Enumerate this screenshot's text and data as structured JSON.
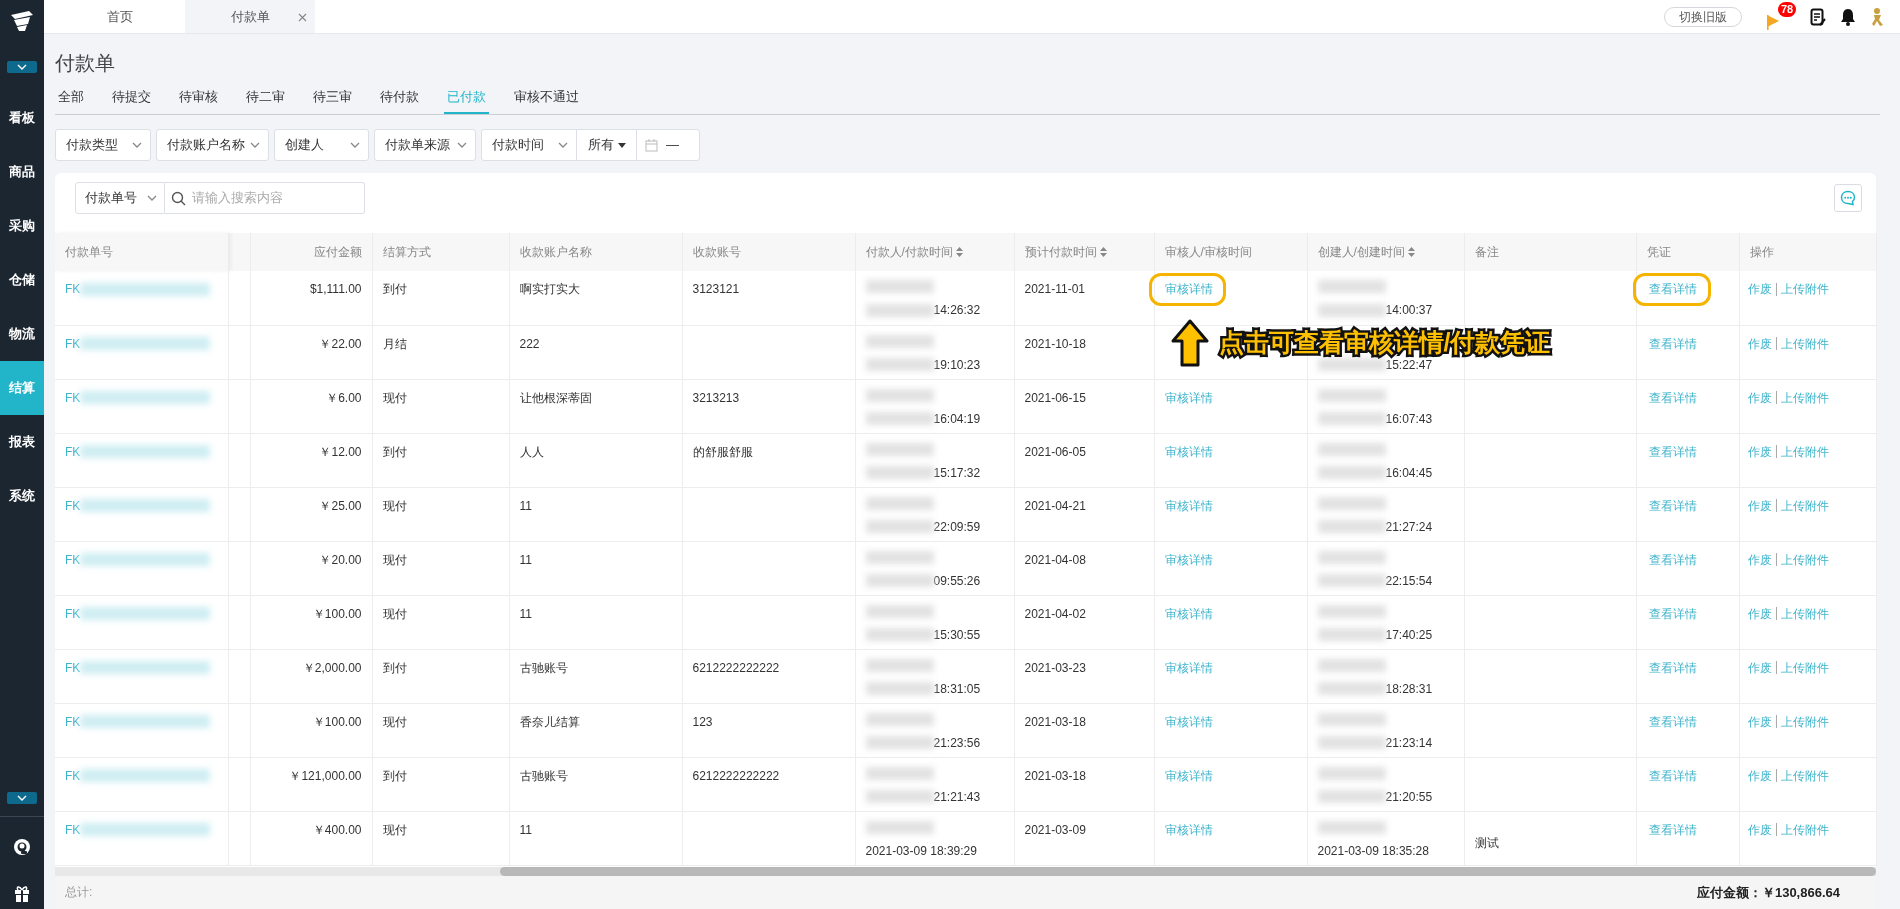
{
  "top_tabs": [
    {
      "label": "首页",
      "selected": false,
      "closable": false
    },
    {
      "label": "付款单",
      "selected": true,
      "closable": true
    }
  ],
  "top_actions": {
    "switch_button": "切换旧版",
    "flag_badge": "78"
  },
  "sidebar": {
    "items": [
      {
        "label": "看板",
        "selected": false
      },
      {
        "label": "商品",
        "selected": false
      },
      {
        "label": "采购",
        "selected": false
      },
      {
        "label": "仓储",
        "selected": false
      },
      {
        "label": "物流",
        "selected": false
      },
      {
        "label": "结算",
        "selected": true
      },
      {
        "label": "报表",
        "selected": false
      },
      {
        "label": "系统",
        "selected": false
      }
    ]
  },
  "page_title": "付款单",
  "status_tabs": [
    {
      "label": "全部",
      "selected": false
    },
    {
      "label": "待提交",
      "selected": false
    },
    {
      "label": "待审核",
      "selected": false
    },
    {
      "label": "待二审",
      "selected": false
    },
    {
      "label": "待三审",
      "selected": false
    },
    {
      "label": "待付款",
      "selected": false
    },
    {
      "label": "已付款",
      "selected": true
    },
    {
      "label": "审核不通过",
      "selected": false
    }
  ],
  "filters": [
    {
      "kind": "select",
      "label": "付款类型"
    },
    {
      "kind": "select",
      "label": "付款账户名称"
    },
    {
      "kind": "select",
      "label": "创建人"
    },
    {
      "kind": "select",
      "label": "付款单来源"
    },
    {
      "kind": "time_range",
      "label": "付款时间",
      "scope": "所有",
      "separator": "—"
    }
  ],
  "search": {
    "field": "付款单号",
    "placeholder": "请输入搜索内容"
  },
  "table": {
    "columns": [
      {
        "label": "付款单号",
        "sortable": false
      },
      {
        "label": "应付金额",
        "sortable": false
      },
      {
        "label": "结算方式",
        "sortable": false
      },
      {
        "label": "收款账户名称",
        "sortable": false
      },
      {
        "label": "收款账号",
        "sortable": false
      },
      {
        "label": "付款人/付款时间",
        "sortable": true
      },
      {
        "label": "预计付款时间",
        "sortable": true
      },
      {
        "label": "审核人/审核时间",
        "sortable": false
      },
      {
        "label": "创建人/创建时间",
        "sortable": true
      },
      {
        "label": "备注",
        "sortable": false
      },
      {
        "label": "凭证",
        "sortable": false
      },
      {
        "label": "操作",
        "sortable": false
      }
    ],
    "rows": [
      {
        "id": "FK",
        "amount": "$1,111.00",
        "settlement": "到付",
        "account_name": "啊实打实大",
        "account_no": "3123121",
        "paid_time": "14:26:32",
        "paid_date_hidden": true,
        "expected": "2021-11-01",
        "audit_link": "审核详情",
        "created_time": "14:00:37",
        "created_date_hidden": true,
        "note": "",
        "voucher": "查看详情",
        "actions": [
          "作废",
          "上传附件"
        ],
        "highlighted": true
      },
      {
        "id": "FK",
        "amount": "￥22.00",
        "settlement": "月结",
        "account_name": "222",
        "account_no": "",
        "paid_time": "19:10:23",
        "paid_date_hidden": true,
        "expected": "2021-10-18",
        "created_time": "15:22:47",
        "created_date_hidden": true,
        "note": "",
        "voucher": "查看详情",
        "actions": [
          "作废",
          "上传附件"
        ],
        "highlighted": false
      },
      {
        "id": "FK",
        "amount": "￥6.00",
        "settlement": "现付",
        "account_name": "让他根深蒂固",
        "account_no": "3213213",
        "paid_time": "16:04:19",
        "paid_date_hidden": true,
        "expected": "2021-06-15",
        "audit_link": "审核详情",
        "created_time": "16:07:43",
        "created_date_hidden": true,
        "note": "",
        "voucher": "查看详情",
        "actions": [
          "作废",
          "上传附件"
        ],
        "highlighted": false
      },
      {
        "id": "FK",
        "amount": "￥12.00",
        "settlement": "到付",
        "account_name": "人人",
        "account_no": "的舒服舒服",
        "paid_time": "15:17:32",
        "paid_date_hidden": true,
        "expected": "2021-06-05",
        "audit_link": "审核详情",
        "created_time": "16:04:45",
        "created_date_hidden": true,
        "note": "",
        "voucher": "查看详情",
        "actions": [
          "作废",
          "上传附件"
        ],
        "highlighted": false
      },
      {
        "id": "FK",
        "amount": "￥25.00",
        "settlement": "现付",
        "account_name": "11",
        "account_no": "",
        "paid_time": "22:09:59",
        "paid_date_hidden": true,
        "expected": "2021-04-21",
        "audit_link": "审核详情",
        "created_time": "21:27:24",
        "created_date_hidden": true,
        "note": "",
        "voucher": "查看详情",
        "actions": [
          "作废",
          "上传附件"
        ],
        "highlighted": false
      },
      {
        "id": "FK",
        "amount": "￥20.00",
        "settlement": "现付",
        "account_name": "11",
        "account_no": "",
        "paid_time": "09:55:26",
        "paid_date_hidden": true,
        "expected": "2021-04-08",
        "audit_link": "审核详情",
        "created_time": "22:15:54",
        "created_date_hidden": true,
        "note": "",
        "voucher": "查看详情",
        "actions": [
          "作废",
          "上传附件"
        ],
        "highlighted": false
      },
      {
        "id": "FK",
        "amount": "￥100.00",
        "settlement": "现付",
        "account_name": "11",
        "account_no": "",
        "paid_time": "15:30:55",
        "paid_date_hidden": true,
        "expected": "2021-04-02",
        "audit_link": "审核详情",
        "created_time": "17:40:25",
        "created_date_hidden": true,
        "note": "",
        "voucher": "查看详情",
        "actions": [
          "作废",
          "上传附件"
        ],
        "highlighted": false
      },
      {
        "id": "FK",
        "amount": "￥2,000.00",
        "settlement": "到付",
        "account_name": "古驰账号",
        "account_no": "6212222222222",
        "paid_time": "18:31:05",
        "paid_date_hidden": true,
        "expected": "2021-03-23",
        "audit_link": "审核详情",
        "created_time": "18:28:31",
        "created_date_hidden": true,
        "note": "",
        "voucher": "查看详情",
        "actions": [
          "作废",
          "上传附件"
        ],
        "highlighted": false
      },
      {
        "id": "FK",
        "amount": "￥100.00",
        "settlement": "现付",
        "account_name": "香奈儿结算",
        "account_no": "123",
        "paid_time": "21:23:56",
        "paid_date_hidden": true,
        "expected": "2021-03-18",
        "audit_link": "审核详情",
        "created_time": "21:23:14",
        "created_date_hidden": true,
        "note": "",
        "voucher": "查看详情",
        "actions": [
          "作废",
          "上传附件"
        ],
        "highlighted": false
      },
      {
        "id": "FK",
        "amount": "￥121,000.00",
        "settlement": "到付",
        "account_name": "古驰账号",
        "account_no": "6212222222222",
        "paid_time": "21:21:43",
        "paid_date_hidden": true,
        "expected": "2021-03-18",
        "audit_link": "审核详情",
        "created_time": "21:20:55",
        "created_date_hidden": true,
        "note": "",
        "voucher": "查看详情",
        "actions": [
          "作废",
          "上传附件"
        ],
        "highlighted": false
      },
      {
        "id": "FK",
        "amount": "￥400.00",
        "settlement": "现付",
        "account_name": "11",
        "account_no": "",
        "paid_time": "2021-03-09 18:39:29",
        "paid_date_hidden": false,
        "expected": "2021-03-09",
        "audit_link": "审核详情",
        "created_time": "2021-03-09 18:35:28",
        "created_date_hidden": false,
        "note": "测试",
        "voucher": "查看详情",
        "actions": [
          "作废",
          "上传附件"
        ],
        "highlighted": false
      }
    ]
  },
  "annotation": {
    "text": "点击可查看审核详情/付款凭证"
  },
  "footer": {
    "label": "总计:",
    "total": "应付金额：￥130,866.64"
  }
}
